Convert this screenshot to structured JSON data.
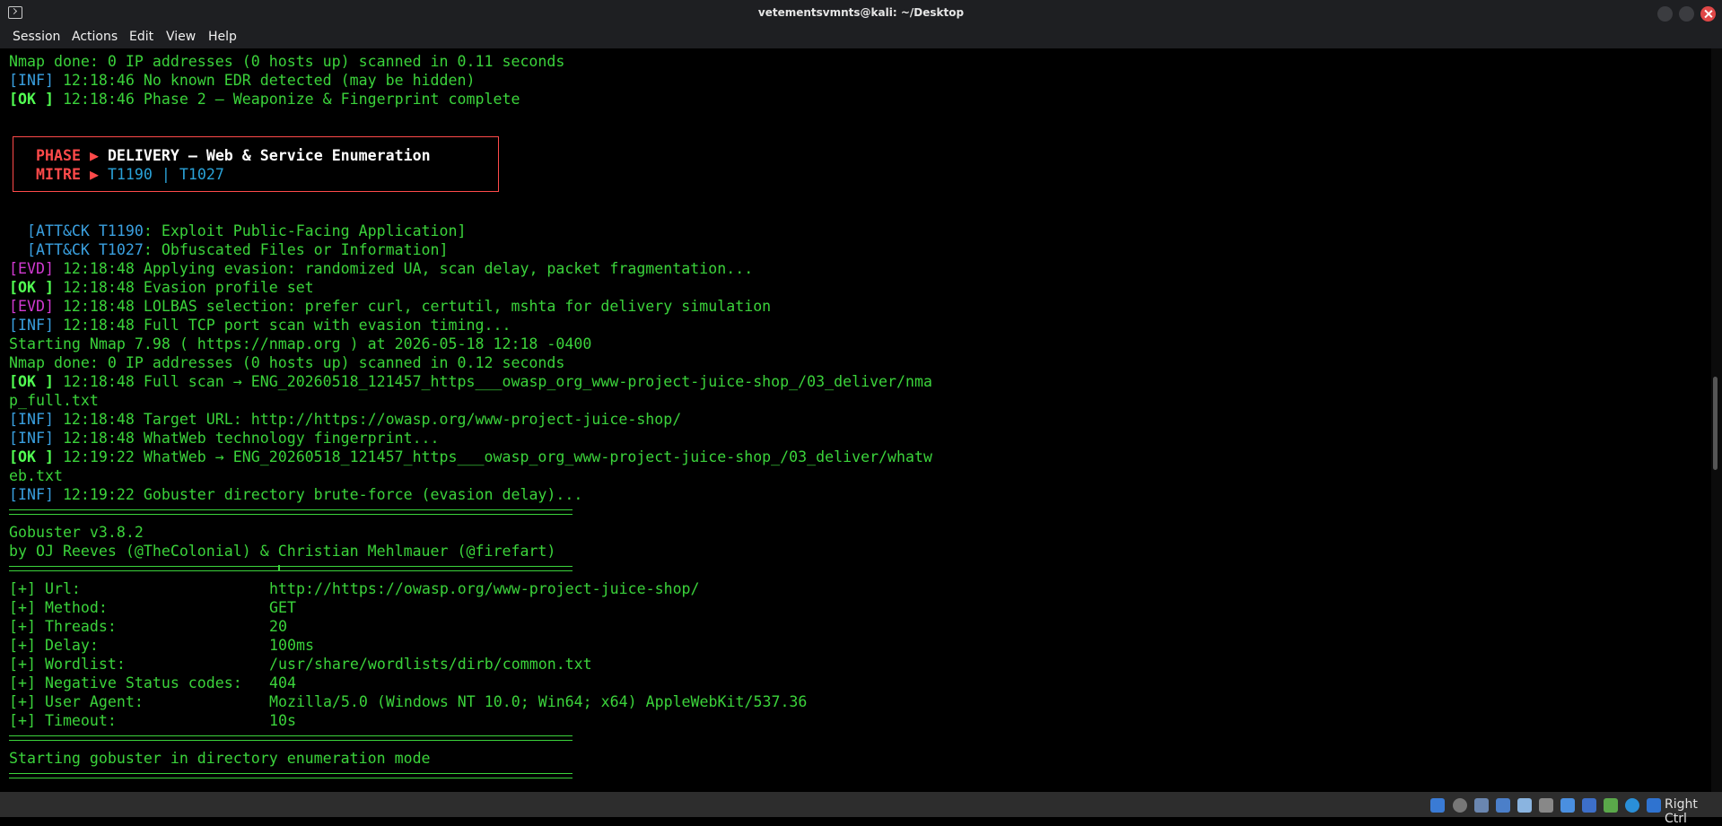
{
  "window": {
    "title": "vetementsvmnts@kali: ~/Desktop"
  },
  "menu": [
    "Session",
    "Actions",
    "Edit",
    "View",
    "Help"
  ],
  "terminal": {
    "l1": "Nmap done: 0 IP addresses (0 hosts up) scanned in 0.11 seconds",
    "l2_tag": "[INF]",
    "l2_text": " 12:18:46 No known EDR detected (may be hidden)",
    "l3_tag": "[OK ]",
    "l3_text": " 12:18:46 Phase 2 — Weaponize & Fingerprint complete",
    "phase_label": "PHASE ▶ ",
    "phase_value": "DELIVERY — Web & Service Enumeration",
    "mitre_label": "MITRE ▶ ",
    "mitre_value": "T1190 | T1027",
    "attack1_tag": "  [ATT&CK T1190",
    "attack1_text": ": Exploit Public-Facing Application]",
    "attack2_tag": "  [ATT&CK T1027",
    "attack2_text": ": Obfuscated Files or Information]",
    "e1_tag": "[EVD]",
    "e1_text": " 12:18:48 Applying evasion: randomized UA, scan delay, packet fragmentation...",
    "e2_tag": "[OK ]",
    "e2_text": " 12:18:48 Evasion profile set",
    "e3_tag": "[EVD]",
    "e3_text": " 12:18:48 LOLBAS selection: prefer curl, certutil, mshta for delivery simulation",
    "e4_tag": "[INF]",
    "e4_text": " 12:18:48 Full TCP port scan with evasion timing...",
    "e5": "Starting Nmap 7.98 ( https://nmap.org ) at 2026-05-18 12:18 -0400",
    "e6": "Nmap done: 0 IP addresses (0 hosts up) scanned in 0.12 seconds",
    "e7_tag": "[OK ]",
    "e7_text": " 12:18:48 Full scan → ENG_20260518_121457_https___owasp_org_www-project-juice-shop_/03_deliver/nma",
    "e7_wrap": "p_full.txt",
    "e8_tag": "[INF]",
    "e8_text": " 12:18:48 Target URL: http://https://owasp.org/www-project-juice-shop/",
    "e9_tag": "[INF]",
    "e9_text": " 12:18:48 WhatWeb technology fingerprint...",
    "e10_tag": "[OK ]",
    "e10_text": " 12:19:22 WhatWeb → ENG_20260518_121457_https___owasp_org_www-project-juice-shop_/03_deliver/whatw",
    "e10_wrap": "eb.txt",
    "e11_tag": "[INF]",
    "e11_text": " 12:19:22 Gobuster directory brute-force (evasion delay)...",
    "gob1": "Gobuster v3.8.2",
    "gob2": "by OJ Reeves (@TheColonial) & Christian Mehlmauer (@firefart)",
    "gob_params": [
      {
        "k": "[+] Url:",
        "v": "http://https://owasp.org/www-project-juice-shop/"
      },
      {
        "k": "[+] Method:",
        "v": "GET"
      },
      {
        "k": "[+] Threads:",
        "v": "20"
      },
      {
        "k": "[+] Delay:",
        "v": "100ms"
      },
      {
        "k": "[+] Wordlist:",
        "v": "/usr/share/wordlists/dirb/common.txt"
      },
      {
        "k": "[+] Negative Status codes:",
        "v": "404"
      },
      {
        "k": "[+] User Agent:",
        "v": "Mozilla/5.0 (Windows NT 10.0; Win64; x64) AppleWebKit/537.36"
      },
      {
        "k": "[+] Timeout:",
        "v": "10s"
      }
    ],
    "gob_start": "Starting gobuster in directory enumeration mode"
  },
  "taskbar": {
    "right_ctrl": "Right Ctrl"
  }
}
